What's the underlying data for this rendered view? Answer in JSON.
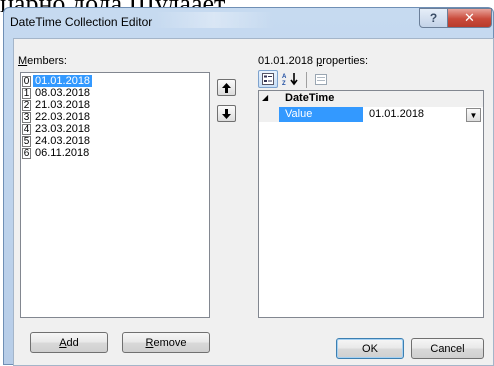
{
  "background_text": "царно дода Шудаает.",
  "window": {
    "title": "DateTime Collection Editor",
    "help_label": "?",
    "close_label": "✕"
  },
  "members": {
    "label_first": "M",
    "label_rest": "embers:",
    "items": [
      {
        "index": "0",
        "value": "01.01.2018",
        "selected": true
      },
      {
        "index": "1",
        "value": "08.03.2018"
      },
      {
        "index": "2",
        "value": "21.03.2018"
      },
      {
        "index": "3",
        "value": "22.03.2018"
      },
      {
        "index": "4",
        "value": "23.03.2018"
      },
      {
        "index": "5",
        "value": "24.03.2018"
      },
      {
        "index": "6",
        "value": "06.11.2018"
      }
    ],
    "move_up_icon": "arrow-up",
    "move_down_icon": "arrow-down"
  },
  "properties": {
    "label_prefix": "01.01.2018 ",
    "label_mnemonic": "p",
    "label_rest": "roperties:",
    "category": "DateTime",
    "property_name": "Value",
    "property_value": "01.01.2018",
    "toolbar": {
      "categorized_icon": "categorized-icon",
      "alphabetical_label": "A↓",
      "pages_icon": "property-pages-icon"
    }
  },
  "buttons": {
    "add_mnemonic": "A",
    "add_rest": "dd",
    "remove_mnemonic": "R",
    "remove_rest": "emove",
    "ok": "OK",
    "cancel": "Cancel"
  },
  "colors": {
    "selection": "#3399ff",
    "close": "#c94a3a"
  }
}
